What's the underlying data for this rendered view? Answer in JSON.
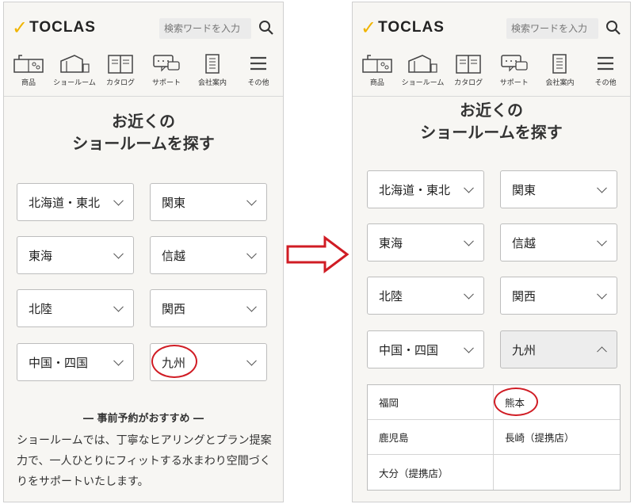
{
  "brand": {
    "logo_text": "TOCLAS"
  },
  "search": {
    "placeholder": "検索ワードを入力"
  },
  "nav": [
    {
      "label": "商品",
      "icon": "kitchen-icon"
    },
    {
      "label": "ショールーム",
      "icon": "showroom-icon"
    },
    {
      "label": "カタログ",
      "icon": "catalog-icon"
    },
    {
      "label": "サポート",
      "icon": "support-icon"
    },
    {
      "label": "会社案内",
      "icon": "building-icon"
    },
    {
      "label": "その他",
      "icon": "menu-icon"
    }
  ],
  "title": {
    "line1": "お近くの",
    "line2": "ショールームを探す"
  },
  "regions": [
    "北海道・東北",
    "関東",
    "東海",
    "信越",
    "北陸",
    "関西",
    "中国・四国",
    "九州"
  ],
  "reservation": {
    "heading": "― 事前予約がおすすめ ―",
    "body": "ショールームでは、丁寧なヒアリングとプラン提案力で、一人ひとりにフィットする水まわり空間づくりをサポートいたします。"
  },
  "kyushu_showrooms": [
    "福岡",
    "熊本",
    "鹿児島",
    "長崎（提携店）",
    "大分（提携店）",
    ""
  ],
  "colors": {
    "accent": "#f0b400",
    "highlight": "#d01c24",
    "panel_bg": "#f7f6f3"
  }
}
